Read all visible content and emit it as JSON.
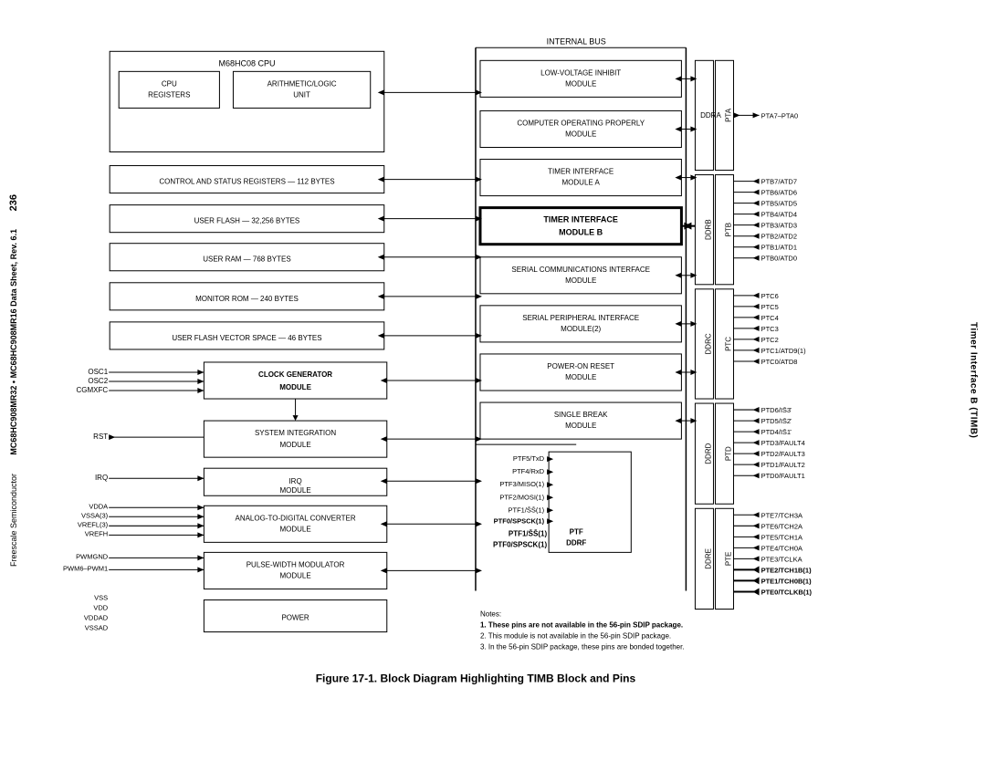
{
  "page": {
    "number": "236",
    "chip_name": "MC68HC908MR32 • MC68HC908MR16 Data Sheet, Rev. 6.1",
    "freescale": "Freescale Semiconductor",
    "right_title": "Timer Interface B (TIMB)"
  },
  "figure": {
    "caption": "Figure 17-1. Block Diagram Highlighting TIMB Block and Pins"
  },
  "notes": {
    "title": "Notes:",
    "note1": "1. These pins are not available in the 56-pin SDIP package.",
    "note2": "2. This module is not available in the 56-pin SDIP package.",
    "note3": "3. In the 56-pin SDIP package, these pins are bonded together."
  },
  "blocks": {
    "cpu": "M68HC08 CPU",
    "cpu_registers": "CPU REGISTERS",
    "alu": "ARITHMETIC/LOGIC UNIT",
    "control_status": "CONTROL AND STATUS REGISTERS — 112 BYTES",
    "user_flash": "USER FLASH — 32,256 BYTES",
    "user_ram": "USER RAM — 768 BYTES",
    "monitor_rom": "MONITOR ROM — 240 BYTES",
    "user_flash_vector": "USER FLASH VECTOR SPACE — 46 BYTES",
    "clock_gen": "CLOCK GENERATOR MODULE",
    "sys_integration": "SYSTEM INTEGRATION MODULE",
    "irq": "IRQ MODULE",
    "adc": "ANALOG-TO-DIGITAL CONVERTER MODULE",
    "pwm": "PULSE-WIDTH MODULATOR MODULE",
    "power": "POWER",
    "low_voltage": "LOW-VOLTAGE INHIBIT MODULE",
    "cop": "COMPUTER OPERATING PROPERLY MODULE",
    "timer_a": "TIMER INTERFACE MODULE A",
    "timer_b": "TIMER INTERFACE MODULE B",
    "sci": "SERIAL COMMUNICATIONS INTERFACE MODULE",
    "spi": "SERIAL PERIPHERAL INTERFACE MODULE(2)",
    "por": "POWER-ON RESET MODULE",
    "single_break": "SINGLE BREAK MODULE"
  },
  "signals": {
    "left_inputs": [
      "OSC1",
      "OSC2",
      "CGMXFC",
      "RST",
      "IRQ",
      "VDDA",
      "VSSA(3)",
      "VREFL(3)",
      "VREFH",
      "PWMGND",
      "PWM6–PWM1",
      "VSS",
      "VDD",
      "VDDAD",
      "VSSAD"
    ],
    "ptf_signals": [
      "PTF5/TxD",
      "PTF4/RxD",
      "PTF3/MISO(1)",
      "PTF2/MOSI(1)",
      "PTF1/SS̄(1)",
      "PTF0/SPSCK(1)"
    ],
    "pta_signals": [
      "PTA7–PTA0"
    ],
    "ddrb_ptb": [
      "PTB7/ATD7",
      "PTB6/ATD6",
      "PTB5/ATD5",
      "PTB4/ATD4",
      "PTB3/ATD3",
      "PTB2/ATD2",
      "PTB1/ATD1",
      "PTB0/ATD0"
    ],
    "ptc_signals": [
      "PTC6",
      "PTC5",
      "PTC4",
      "PTC3",
      "PTC2",
      "PTC1/ATD9(1)",
      "PTC0/ATD8"
    ],
    "ptd_signals": [
      "PTD6/IS̄3̄",
      "PTD5/IS̄2̄",
      "PTD4/IS̄1̄",
      "PTD3/FAULT4",
      "PTD2/FAULT3",
      "PTD1/FAULT2",
      "PTD0/FAULT1"
    ],
    "pte_signals": [
      "PTE7/TCH3A",
      "PTE6/TCH2A",
      "PTE5/TCH1A",
      "PTE4/TCH0A",
      "PTE3/TCLKA",
      "PTE2/TCH1B(1)",
      "PTE1/TCH0B(1)",
      "PTE0/TCLKB(1)"
    ],
    "ddr_labels": [
      "DDRA",
      "DDRB",
      "DDRC",
      "DDRD",
      "DDRE",
      "DDRF"
    ]
  }
}
